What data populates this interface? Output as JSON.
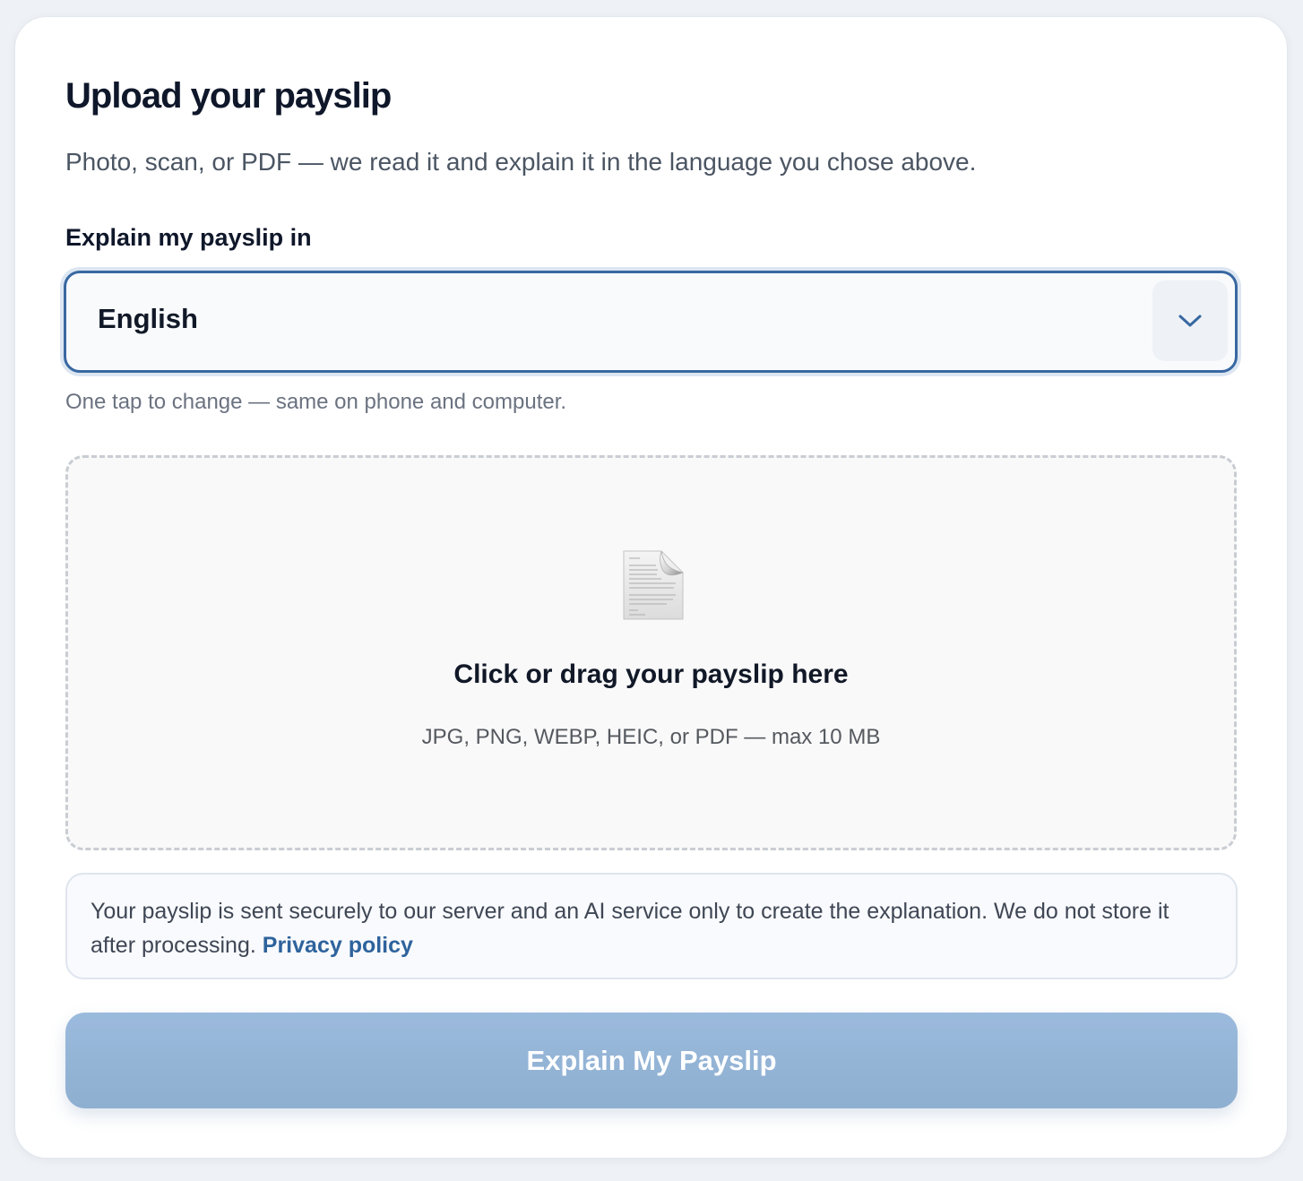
{
  "upload": {
    "title": "Upload your payslip",
    "subtitle": "Photo, scan, or PDF — we read it and explain it in the language you chose above."
  },
  "language": {
    "label": "Explain my payslip in",
    "selected": "English",
    "helper": "One tap to change — same on phone and computer."
  },
  "dropzone": {
    "icon": "document-icon",
    "title": "Click or drag your payslip here",
    "hint": "JPG, PNG, WEBP, HEIC, or PDF — max 10 MB"
  },
  "notice": {
    "text": "Your payslip is sent securely to our server and an AI service only to create the explanation. We do not store it after processing.",
    "link_label": "Privacy policy"
  },
  "submit": {
    "label": "Explain My Payslip"
  },
  "colors": {
    "accent": "#3868a1",
    "link": "#2e639c",
    "button": "#94b5d8"
  }
}
